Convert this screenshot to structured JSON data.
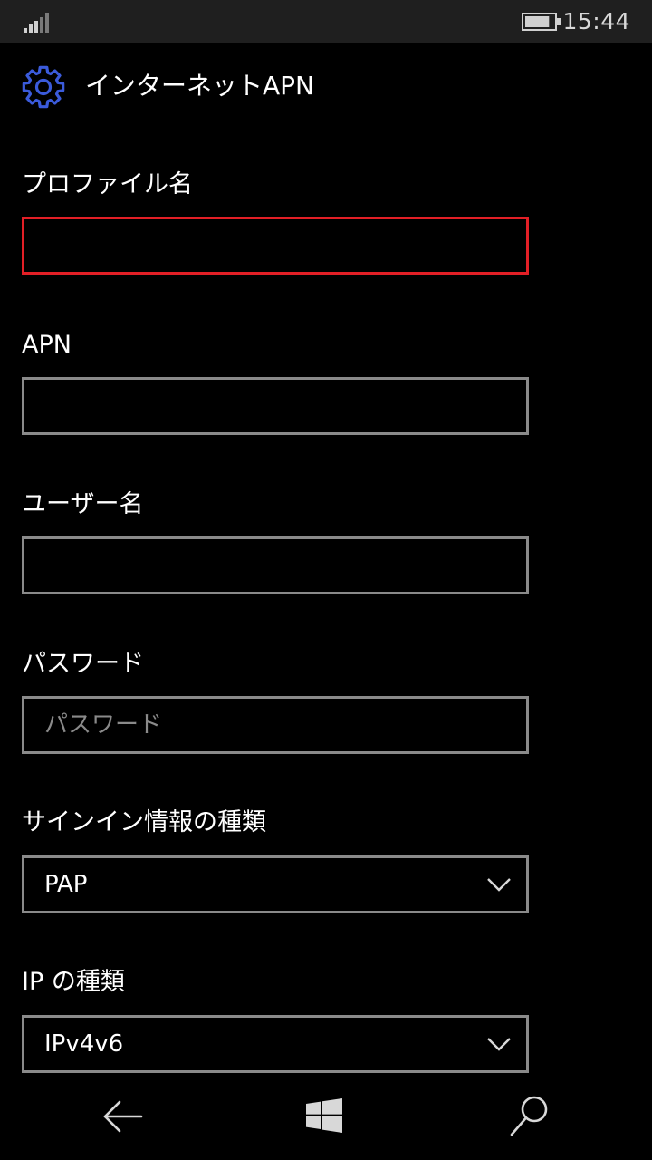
{
  "status_bar": {
    "time": "15:44",
    "signal_icon": "signal-icon",
    "battery_icon": "battery-icon",
    "battery_level": 0.85
  },
  "header": {
    "icon": "gear-icon",
    "title": "インターネットAPN"
  },
  "form": {
    "profile_name": {
      "label": "プロファイル名",
      "value": "",
      "placeholder": ""
    },
    "apn": {
      "label": "APN",
      "value": "",
      "placeholder": ""
    },
    "user_name": {
      "label": "ユーザー名",
      "value": "",
      "placeholder": ""
    },
    "password": {
      "label": "パスワード",
      "value": "",
      "placeholder": "パスワード"
    },
    "signin_type": {
      "label": "サインイン情報の種類",
      "selected": "PAP"
    },
    "ip_type": {
      "label": "IP の種類",
      "selected": "IPv4v6"
    }
  },
  "colors": {
    "accent_blue": "#3b5bdb",
    "focus_border": "#e21f26",
    "field_border": "#8a8a8a",
    "status_bar_bg": "#1f1f1f"
  },
  "navbar": {
    "back_icon": "back-arrow-icon",
    "start_icon": "windows-start-icon",
    "search_icon": "search-icon"
  }
}
